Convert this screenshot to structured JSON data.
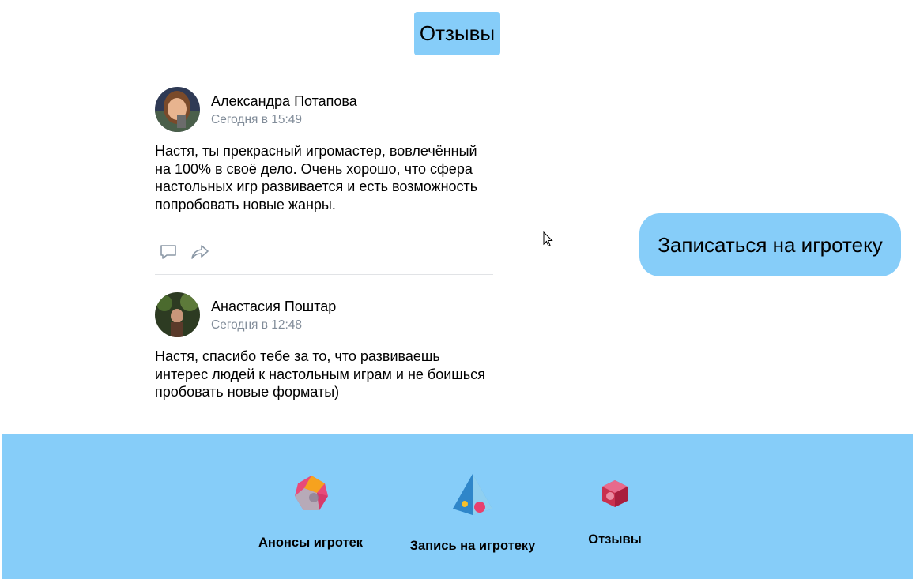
{
  "header": {
    "title": "Отзывы"
  },
  "reviews": [
    {
      "author": "Александра Потапова",
      "time": "Сегодня в 15:49",
      "text": "Настя, ты прекрасный игромастер, вовлечённый на 100% в своё дело. Очень хорошо, что сфера настольных игр развивается и есть возможность попробовать новые жанры."
    },
    {
      "author": "Анастасия Поштар",
      "time": "Сегодня в 12:48",
      "text": "Настя, спасибо тебе за то, что развиваешь интерес людей к настольным играм и не боишься пробовать новые форматы)"
    }
  ],
  "cta": {
    "label": "Записаться на игротеку"
  },
  "footer_nav": [
    {
      "label": "Анонсы игротек",
      "icon": "gem-icon"
    },
    {
      "label": "Запись на игротеку",
      "icon": "pyramid-icon"
    },
    {
      "label": "Отзывы",
      "icon": "cube-icon"
    }
  ],
  "colors": {
    "accent": "#86cdf9",
    "muted_text": "#818c99",
    "divider": "#e1e3e6"
  }
}
